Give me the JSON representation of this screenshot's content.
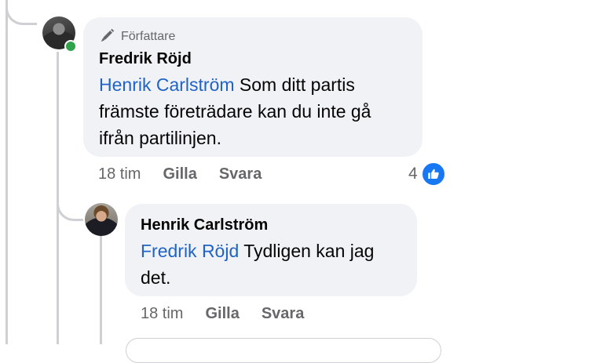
{
  "main_comment": {
    "badge_label": "Författare",
    "author": "Fredrik Röjd",
    "mention": "Henrik Carlström",
    "text_line1_rest": " Som ditt partis",
    "text_line2": "främste företrädare kan du inte gå",
    "text_line3": "ifrån partilinjen.",
    "time": "18 tim",
    "like_label": "Gilla",
    "reply_label": "Svara",
    "reaction_count": "4"
  },
  "reply_comment": {
    "author": "Henrik Carlström",
    "mention": "Fredrik Röjd",
    "text_line1_rest": " Tydligen kan jag",
    "text_line2": "det.",
    "time": "18 tim",
    "like_label": "Gilla",
    "reply_label": "Svara"
  },
  "colors": {
    "bubble": "#f0f2f5",
    "mention": "#1f63c7",
    "like_blue": "#1877f2",
    "online": "#31a24c"
  },
  "icons": {
    "author_badge": "pen-icon",
    "reaction": "like-icon"
  }
}
